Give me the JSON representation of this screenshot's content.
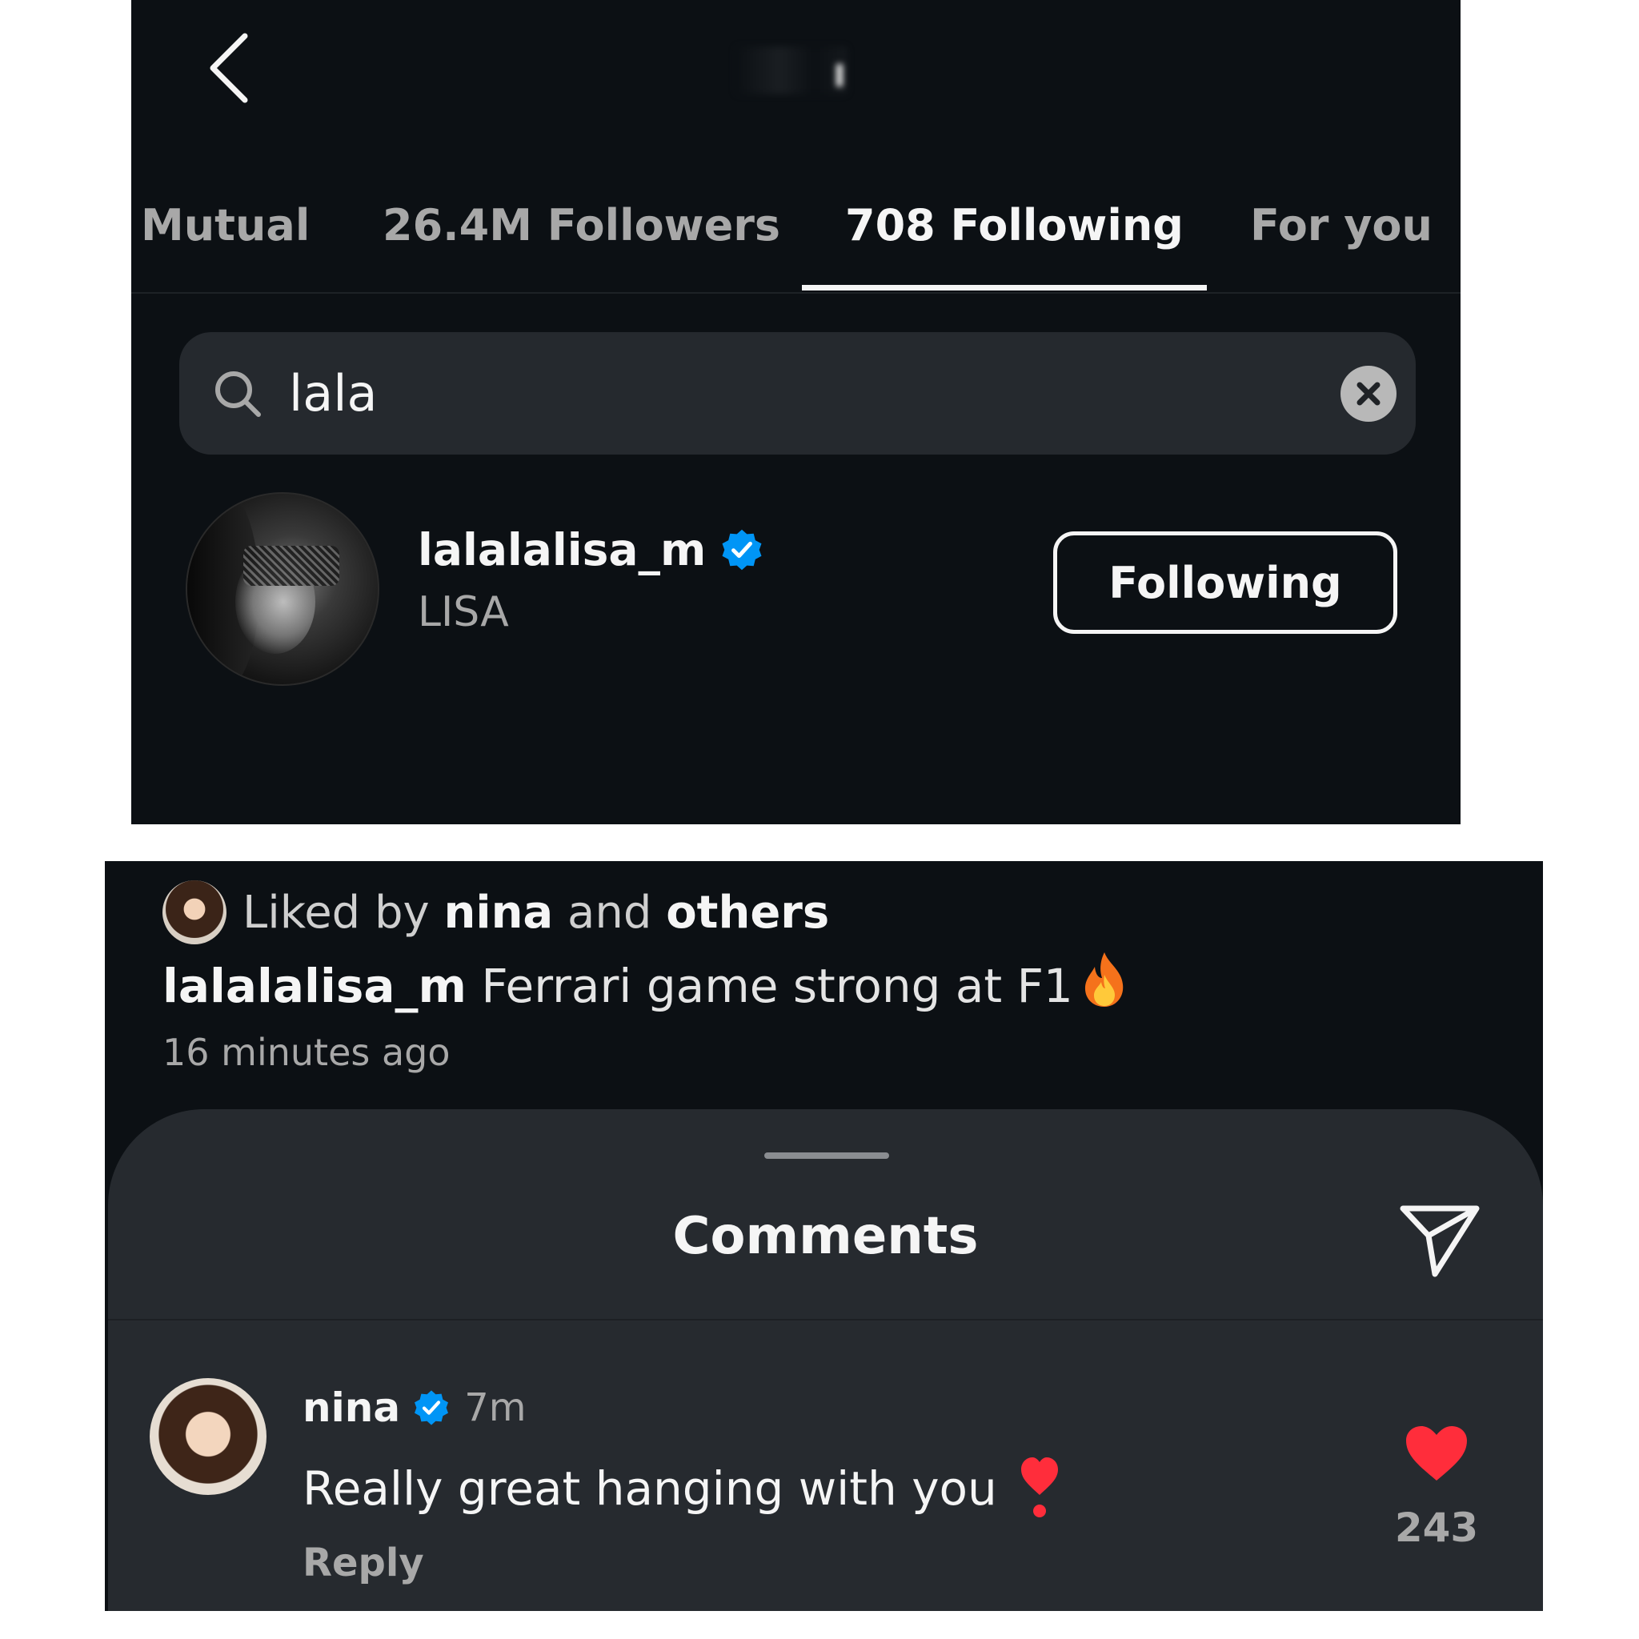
{
  "top_panel": {
    "tabs": [
      {
        "label": "Mutual",
        "active": false
      },
      {
        "label": "26.4M Followers",
        "active": false
      },
      {
        "label": "708 Following",
        "active": true
      },
      {
        "label": "For you",
        "active": false
      }
    ],
    "search": {
      "value": "lala"
    },
    "result": {
      "username": "lalalalisa_m",
      "full_name": "LISA",
      "verified": true,
      "button_label": "Following"
    }
  },
  "post": {
    "liked_by_prefix": "Liked by",
    "liked_by_user": "nina",
    "liked_by_joiner": "and",
    "liked_by_suffix": "others",
    "caption_user": "lalalalisa_m",
    "caption_text": "Ferrari game strong at F1",
    "timestamp": "16 minutes ago"
  },
  "comments_sheet": {
    "title": "Comments",
    "comment": {
      "username": "nina",
      "verified": true,
      "time": "7m",
      "text": "Really great hanging with you",
      "reply_label": "Reply",
      "like_count": "243",
      "liked": true
    }
  },
  "colors": {
    "background": "#0c1014",
    "sheet": "#262a2f",
    "verified_blue": "#0095f6",
    "like_red": "#ff2d3b",
    "secondary_text": "#a8a8a8"
  },
  "icons": [
    "back-chevron-icon",
    "search-icon",
    "clear-icon",
    "verified-icon",
    "fire-emoji-icon",
    "share-icon",
    "heart-exclamation-emoji-icon",
    "heart-icon"
  ]
}
